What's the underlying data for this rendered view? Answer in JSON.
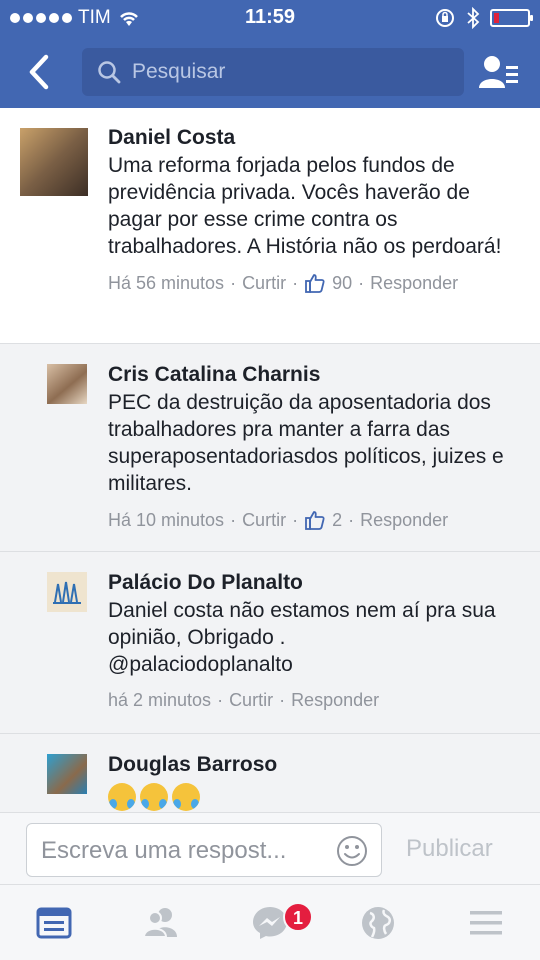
{
  "status_bar": {
    "carrier": "TIM",
    "time": "11:59"
  },
  "nav": {
    "search_placeholder": "Pesquisar"
  },
  "comments": [
    {
      "author": "Daniel Costa",
      "text": "Uma reforma forjada pelos fundos de previdência privada. Vocês haverão de pagar por esse crime contra os trabalhadores. A História não os perdoará!",
      "time": "Há 56 minutos",
      "like_action": "Curtir",
      "likes": "90",
      "reply_action": "Responder"
    },
    {
      "author": "Cris Catalina Charnis",
      "text": "PEC da destruição da aposentadoria dos trabalhadores pra manter a farra das superaposentadoriasdos políticos, juizes e militares.",
      "time": "Há 10 minutos",
      "like_action": "Curtir",
      "likes": "2",
      "reply_action": "Responder"
    },
    {
      "author": "Palácio Do Planalto",
      "text": "Daniel costa não estamos nem aí pra sua opinião,  Obrigado .\n@palaciodoplanalto",
      "time": "há 2 minutos",
      "like_action": "Curtir",
      "reply_action": "Responder"
    },
    {
      "author": "Douglas Barroso",
      "emoji_icon": "face-with-tears-of-joy"
    }
  ],
  "composer": {
    "placeholder": "Escreva uma respost...",
    "publish_label": "Publicar"
  },
  "tabbar": {
    "messenger_badge": "1",
    "icons": [
      "news-feed-icon",
      "friends-icon",
      "messenger-icon",
      "globe-icon",
      "menu-icon"
    ]
  },
  "colors": {
    "brand": "#4267b2",
    "search_bg": "#3a5a9f",
    "badge": "#e41e3f",
    "meta_text": "#90949c",
    "active_tab": "#4267b2",
    "inactive_tab": "#bec3c9"
  }
}
